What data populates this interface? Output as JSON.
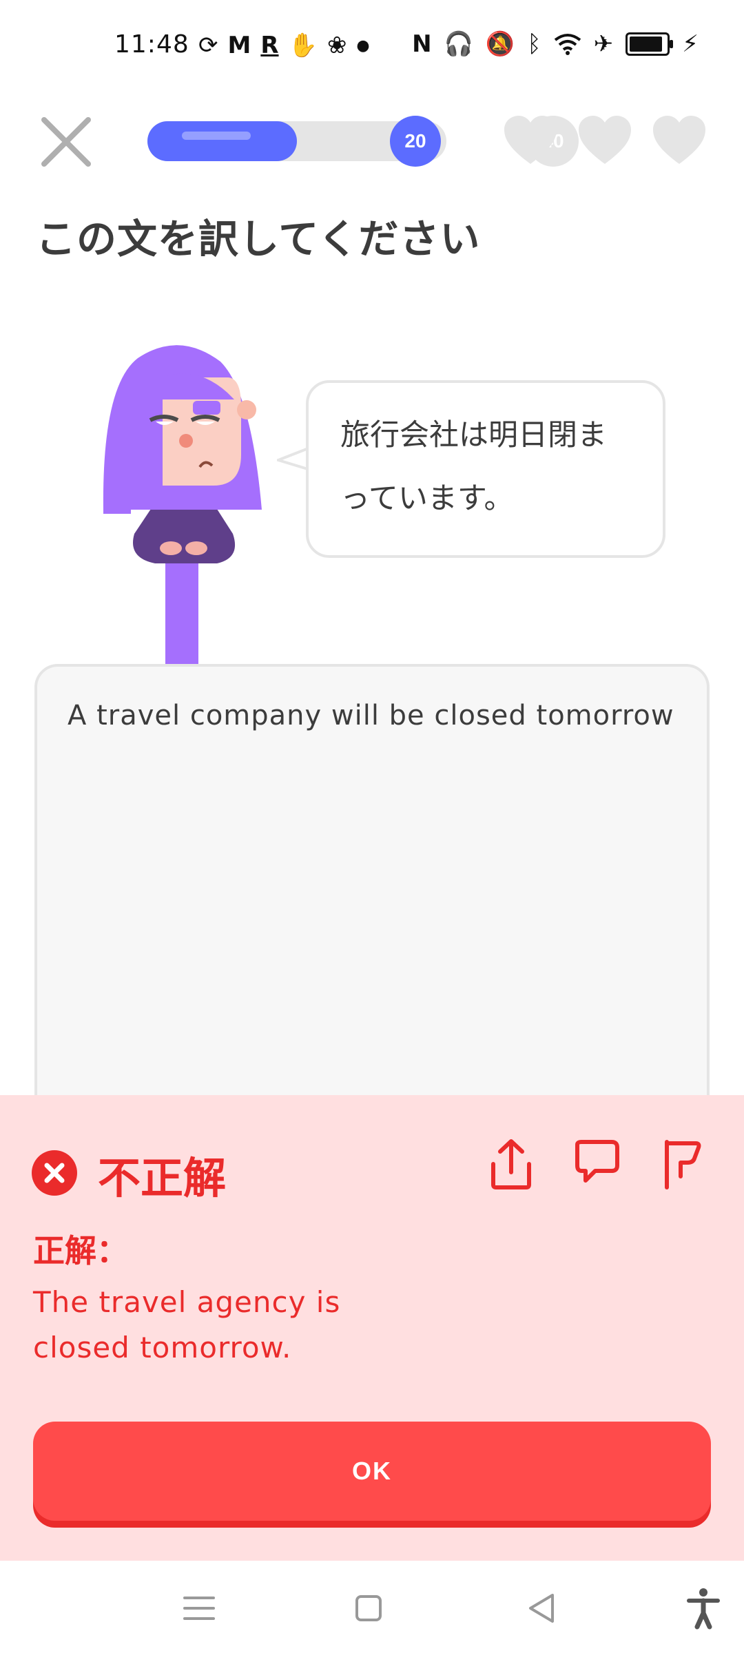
{
  "status_bar": {
    "time": "11:48",
    "icons": [
      "sync-icon",
      "gmail-icon",
      "r-icon",
      "hand-icon",
      "lotus-icon",
      "dot-icon",
      "nfc-icon",
      "headphones-icon",
      "bell-off-icon",
      "bluetooth-icon",
      "wifi-icon",
      "airplane-icon",
      "battery-icon",
      "charging-icon"
    ]
  },
  "progress": {
    "current": "20",
    "target": "40",
    "fraction": 0.5,
    "color": "#5c6cff"
  },
  "hearts": {
    "count": 3,
    "color": "#e5e5e5"
  },
  "prompt": "この文を訳してください",
  "speech": {
    "line1": "旅行会社は明日閉ま",
    "line2": "っています。"
  },
  "user_answer": "A travel company will be closed tomorrow",
  "feedback": {
    "title": "不正解",
    "label": "正解：",
    "correct_answer": "The travel agency is closed tomorrow.",
    "ok_label": "OK",
    "background": "#ffdfe0",
    "accent": "#ea2b2b",
    "actions": [
      "share-icon",
      "comment-icon",
      "flag-icon"
    ]
  },
  "nav_bar": [
    "menu-icon",
    "home-square-icon",
    "back-triangle-icon",
    "accessibility-icon"
  ]
}
